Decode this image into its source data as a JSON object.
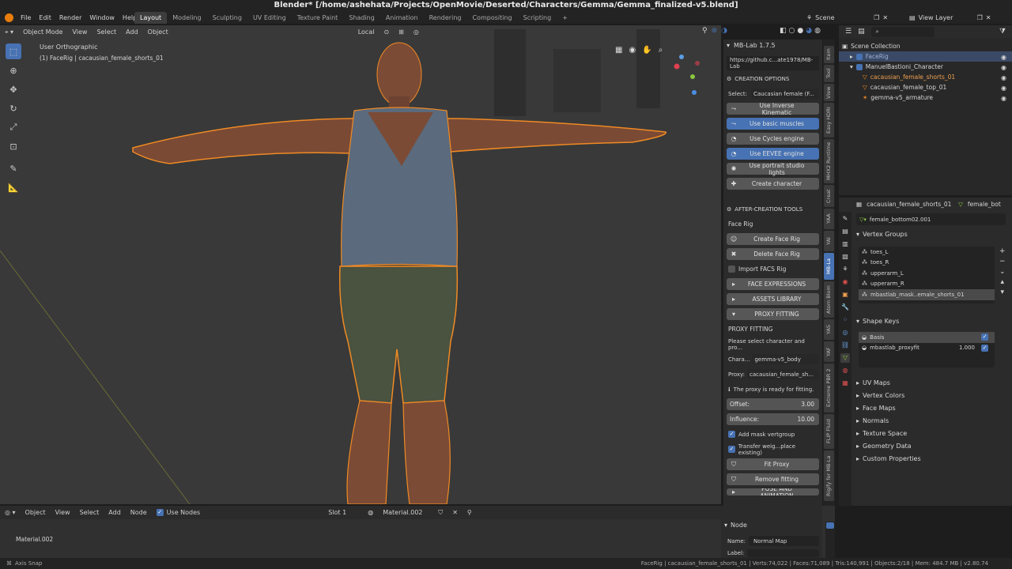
{
  "window": {
    "title": "Blender* [/home/ashehata/Projects/OpenMovie/Deserted/Characters/Gemma/Gemma_finalized-v5.blend]"
  },
  "menu": [
    "File",
    "Edit",
    "Render",
    "Window",
    "Help"
  ],
  "workspaces": [
    "Layout",
    "Modeling",
    "Sculpting",
    "UV Editing",
    "Texture Paint",
    "Shading",
    "Animation",
    "Rendering",
    "Compositing",
    "Scripting"
  ],
  "topright": {
    "scene": "Scene",
    "viewlayer": "View Layer"
  },
  "viewport": {
    "mode": "Object Mode",
    "menus": [
      "View",
      "Select",
      "Add",
      "Object"
    ],
    "orientation": "Local",
    "view_name": "User Orthographic",
    "object_info": "(1) FaceRig | cacausian_female_shorts_01"
  },
  "npanel": {
    "title": "MB-Lab 1.7.5",
    "url": "https://github.c...ate1978/MB-Lab",
    "creation_header": "CREATION OPTIONS",
    "select_label": "Select:",
    "select_value": "Caucasian female (F...",
    "buttons": [
      {
        "label": "Use Inverse Kinematic",
        "active": false
      },
      {
        "label": "Use basic muscles",
        "active": true
      },
      {
        "label": "Use Cycles engine",
        "active": false
      },
      {
        "label": "Use EEVEE engine",
        "active": true
      },
      {
        "label": "Use portrait studio lights",
        "active": false
      },
      {
        "label": "Create character",
        "active": false
      }
    ],
    "after_header": "AFTER-CREATION TOOLS",
    "face_rig_label": "Face Rig",
    "create_face_rig": "Create Face Rig",
    "delete_face_rig": "Delete Face Rig",
    "import_facs": "Import FACS Rig",
    "face_expressions": "FACE EXPRESSIONS",
    "assets_library": "ASSETS LIBRARY",
    "proxy_fitting_btn": "PROXY FITTING",
    "proxy_fitting_header": "PROXY FITTING",
    "please_select": "Please select character and pro...",
    "chara_label": "Chara...",
    "chara_value": "gemma-v5_body",
    "proxy_label": "Proxy:",
    "proxy_value": "cacausian_female_sh...",
    "ready_msg": "The proxy is ready for fitting.",
    "offset_label": "Offset:",
    "offset_value": "3.00",
    "influence_label": "Influence:",
    "influence_value": "10.00",
    "add_mask": "Add mask vertgroup",
    "transfer": "Transfer weig...place existing)",
    "fit_proxy": "Fit Proxy",
    "remove_fitting": "Remove fitting",
    "pose_anim": "POSE AND ANIMATION"
  },
  "sidetabs": [
    "Item",
    "Tool",
    "View",
    "Easy HDRI",
    "MHX2 Runtime",
    "Creat",
    "YAA",
    "YAI",
    "MB-La",
    "Atom Blom",
    "YAS",
    "YAF",
    "Extreme PBR 2",
    "FLIP Fluid",
    "Rigify for MB-La"
  ],
  "outliner": {
    "header": "Scene Collection",
    "items": [
      {
        "name": "FaceRig",
        "indent": 1,
        "selected": true
      },
      {
        "name": "ManuelBastioni_Character",
        "indent": 1,
        "selected": false
      },
      {
        "name": "cacausian_female_shorts_01",
        "indent": 2,
        "selected": false
      },
      {
        "name": "cacausian_female_top_01",
        "indent": 2,
        "selected": false
      },
      {
        "name": "gemma-v5_armature",
        "indent": 2,
        "selected": false
      }
    ]
  },
  "properties": {
    "object_name": "cacausian_female_shorts_01",
    "data_name": "female_bot",
    "mesh_name": "female_bottom02.001",
    "vertex_groups_header": "Vertex Groups",
    "vertex_groups": [
      "toes_L",
      "toes_R",
      "upperarm_L",
      "upperarm_R",
      "mbastlab_mask..emale_shorts_01"
    ],
    "shape_keys_header": "Shape Keys",
    "shape_keys": [
      {
        "name": "Basis",
        "value": ""
      },
      {
        "name": "mbastlab_proxyfit",
        "value": "1.000"
      }
    ],
    "sections": [
      "UV Maps",
      "Vertex Colors",
      "Face Maps",
      "Normals",
      "Texture Space",
      "Geometry Data",
      "Custom Properties"
    ]
  },
  "node_editor": {
    "type": "Object",
    "menus": [
      "View",
      "Select",
      "Add",
      "Node"
    ],
    "use_nodes": "Use Nodes",
    "slot": "Slot 1",
    "material": "Material.002",
    "breadcrumb": "Material.002",
    "panel_title": "Node",
    "name_label": "Name:",
    "name_value": "Normal Map",
    "label_label": "Label:"
  },
  "statusbar": {
    "left": "Axis Snap",
    "right": "FaceRig | cacausian_female_shorts_01 | Verts:74,022 | Faces:71,089 | Tris:140,991 | Objects:2/18 | Mem: 484.7 MB | v2.80.74"
  },
  "colors": {
    "accent": "#4772b3",
    "select_orange": "#f08a24",
    "bg": "#393939"
  }
}
